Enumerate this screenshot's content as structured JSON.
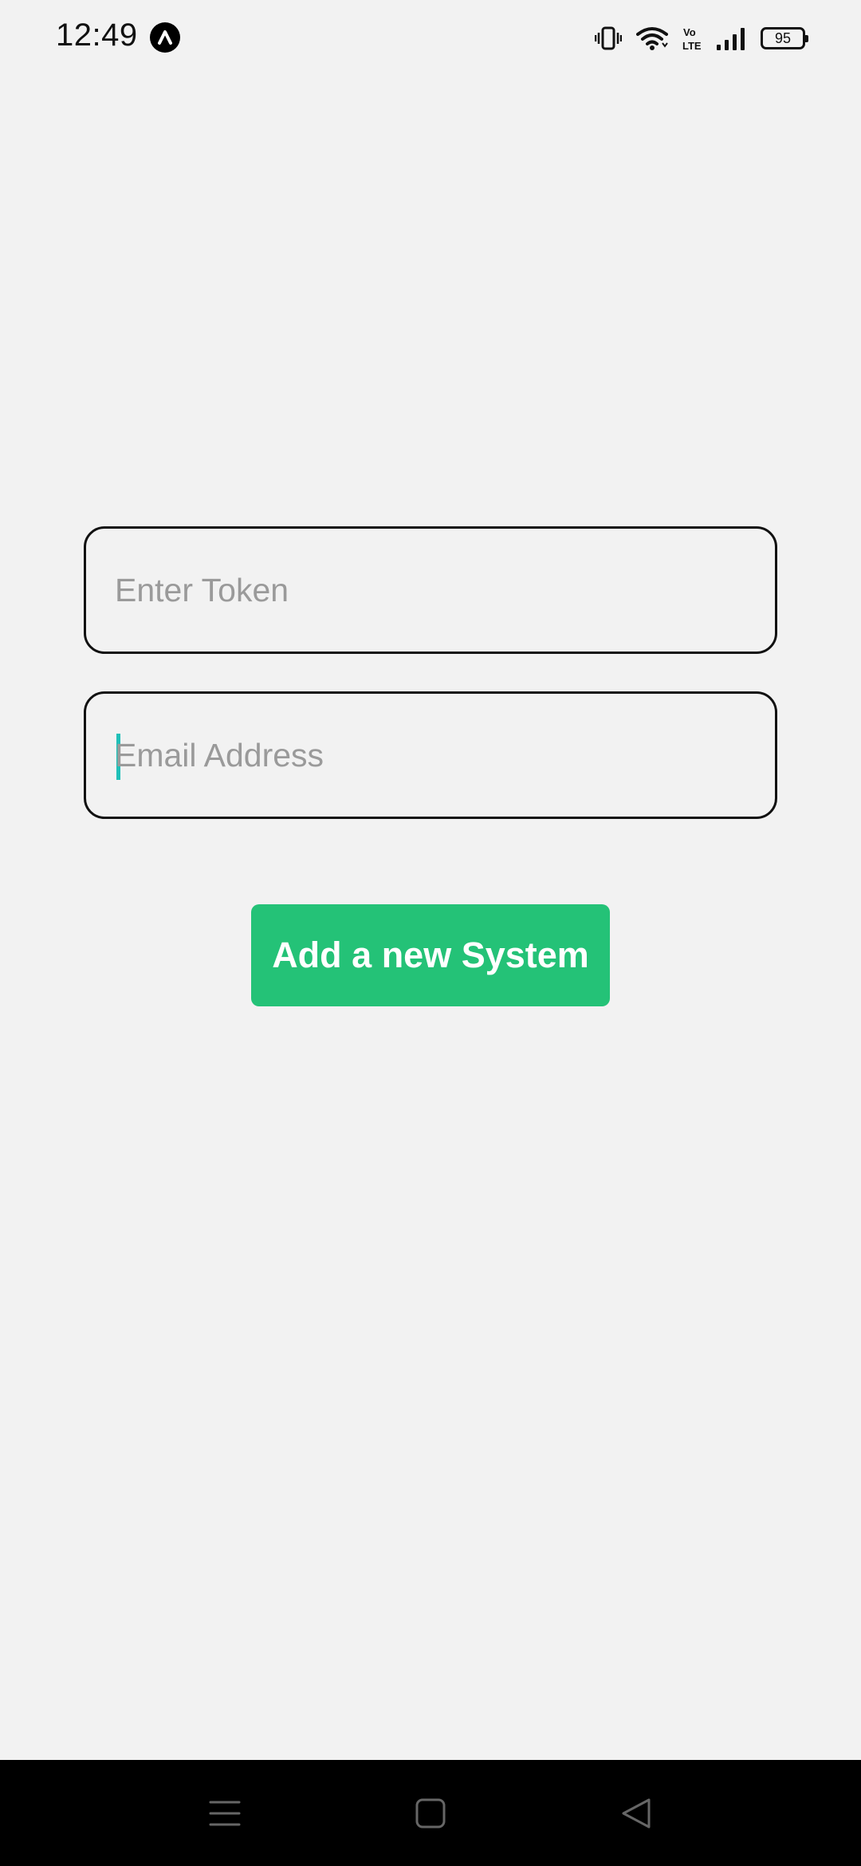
{
  "status_bar": {
    "time": "12:49",
    "battery_level": "95",
    "icons": [
      "app-icon",
      "vibrate-icon",
      "wifi-icon",
      "volte-icon",
      "signal-icon",
      "battery-icon"
    ]
  },
  "form": {
    "token": {
      "placeholder": "Enter Token",
      "value": ""
    },
    "email": {
      "placeholder": "Email Address",
      "value": ""
    },
    "submit_label": "Add a new System"
  },
  "nav_bar": {
    "icons": [
      "menu-icon",
      "home-icon",
      "back-icon"
    ]
  },
  "colors": {
    "background": "#f2f2f2",
    "button": "#24c277",
    "caret": "#1fc0b8",
    "field_border": "#111111",
    "placeholder": "#9a9a9a"
  }
}
